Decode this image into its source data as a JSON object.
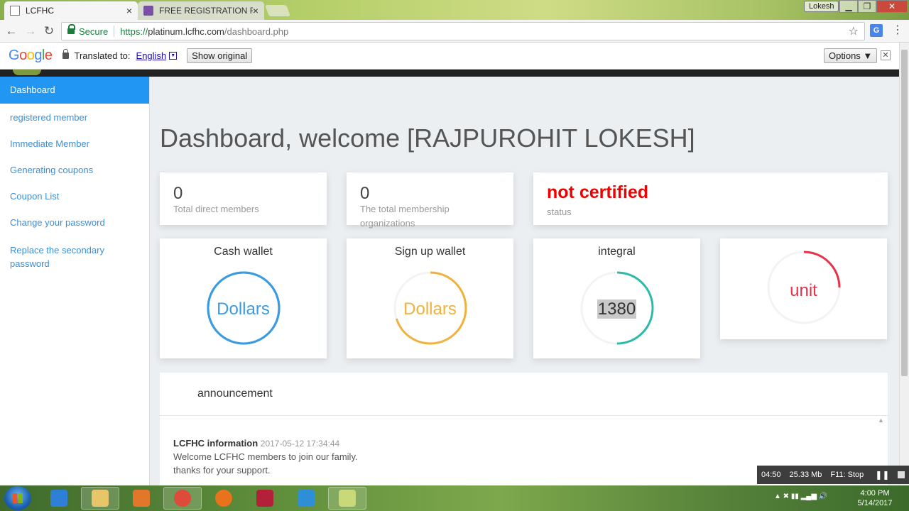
{
  "browser": {
    "tabs": [
      {
        "title": "LCFHC",
        "active": true
      },
      {
        "title": "FREE REGISTRATION FOR",
        "active": false
      }
    ],
    "tab_close_glyph": "×",
    "window_user": "Lokesh",
    "window_controls": {
      "minimize": "▁",
      "maximize": "❐",
      "close": "✕"
    },
    "nav": {
      "back": "←",
      "forward": "→",
      "reload": "↻"
    },
    "secure_label": "Secure",
    "url_scheme": "https://",
    "url_host": "platinum.lcfhc.com",
    "url_path": "/dashboard.php",
    "star_glyph": "☆",
    "menu_glyph": "⋮",
    "translate_icon_letter": "G"
  },
  "translate_bar": {
    "logo_letters": [
      "G",
      "o",
      "o",
      "g",
      "l",
      "e"
    ],
    "translated_to_label": "Translated to:",
    "language": "English",
    "dropdown_glyph": "▼",
    "show_original_label": "Show original",
    "options_label": "Options ▼",
    "close_glyph": "✕"
  },
  "sidebar": {
    "items": [
      {
        "label": "Dashboard",
        "active": true
      },
      {
        "label": "registered member"
      },
      {
        "label": "Immediate Member"
      },
      {
        "label": "Generating coupons"
      },
      {
        "label": "Coupon List"
      },
      {
        "label": "Change your password"
      },
      {
        "label": "Replace the secondary password"
      }
    ]
  },
  "main": {
    "title": "Dashboard, welcome [RAJPUROHIT LOKESH]",
    "stats": [
      {
        "value": "0",
        "label": "Total direct members"
      },
      {
        "value": "0",
        "label": "The total membership organizations"
      },
      {
        "value": "not certified",
        "label": "status"
      }
    ],
    "wallets": [
      {
        "title": "Cash wallet",
        "center": "Dollars",
        "color": "#3a9be0",
        "fraction": 1.0,
        "track": "#3a9be0"
      },
      {
        "title": "Sign up wallet",
        "center": "Dollars",
        "color": "#f0b23c",
        "fraction": 0.7,
        "track": "#f3f3f3"
      },
      {
        "title": "integral",
        "center": "1380",
        "color": "#2dbba9",
        "fraction": 0.5,
        "track": "#f3f3f3"
      },
      {
        "title": "",
        "center": "unit",
        "color": "#e5334b",
        "fraction": 0.25,
        "track": "#f3f3f3"
      }
    ],
    "announcement": {
      "title": "announcement",
      "scroll_up_glyph": "▲",
      "entries": [
        {
          "source": "LCFHC information",
          "date": "2017-05-12 17:34:44",
          "lines": [
            "Welcome LCFHC members to join our family.",
            "thanks for your support."
          ]
        }
      ]
    }
  },
  "recorder": {
    "elapsed": "04:50",
    "size": "25.33 Mb",
    "stop_hint": "F11: Stop",
    "pause_glyph": "❚❚"
  },
  "taskbar": {
    "apps": [
      {
        "name": "internet-explorer",
        "color": "#2f7fd6"
      },
      {
        "name": "file-explorer",
        "color": "#e9c56a"
      },
      {
        "name": "media-player",
        "color": "#e0772a"
      },
      {
        "name": "chrome",
        "color": "#dd4b39"
      },
      {
        "name": "firefox",
        "color": "#e8731c"
      },
      {
        "name": "access",
        "color": "#b3203a"
      },
      {
        "name": "snipping-tool",
        "color": "#2f8fd6"
      },
      {
        "name": "active-window",
        "color": "#c9d97a"
      }
    ],
    "tray_glyphs": "▲  ✖  ▮▮  ▂▄▆  🔊",
    "clock_time": "4:00 PM",
    "clock_date": "5/14/2017"
  }
}
